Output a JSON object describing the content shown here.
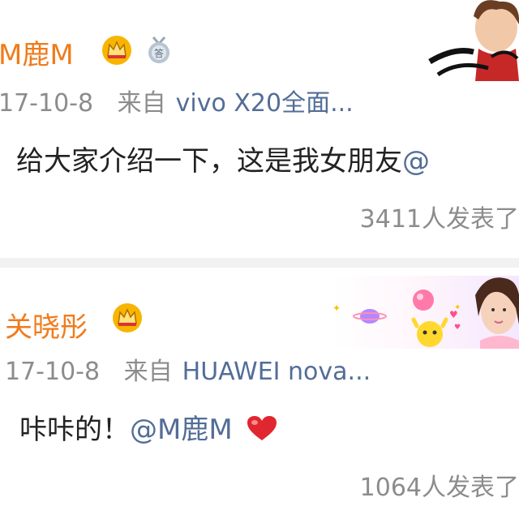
{
  "post1": {
    "username": "M鹿M",
    "date": "17-10-8",
    "source_prefix": "来自",
    "device": "vivo X20全面...",
    "text": "给大家介绍一下，这是我女朋友",
    "mention": "@",
    "repost_stat": "3411人发表了"
  },
  "post2": {
    "username": "关晓彤",
    "date": "17-10-8",
    "source_prefix": "来自",
    "device": "HUAWEI nova...",
    "text": "咔咔的！",
    "mention": "@M鹿M",
    "repost_stat": "1064人发表了"
  },
  "colors": {
    "username": "#f07b1b",
    "link": "#536d97",
    "meta": "#8c8c8c",
    "heart": "#e0262f"
  },
  "icons": [
    "crown-icon",
    "medal-badge-icon",
    "heart-icon",
    "avatar-decoration"
  ]
}
